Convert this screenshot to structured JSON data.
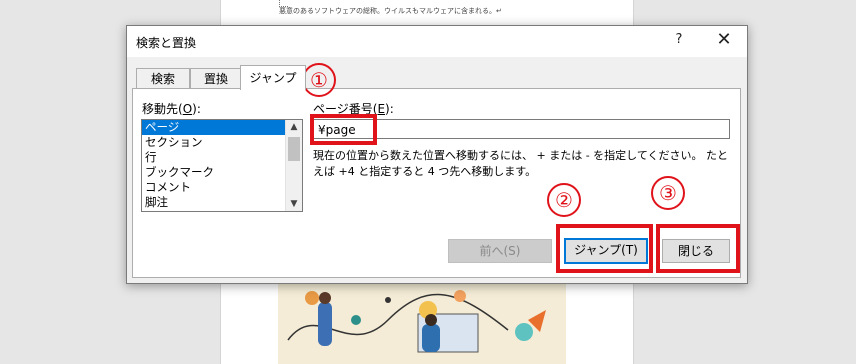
{
  "document": {
    "text_line": "悪意のあるソフトウェアの総称。ウイルスもマルウェアに含まれる。↵"
  },
  "dialog": {
    "title": "検索と置換",
    "help_label": "?",
    "close_label": "✕",
    "tabs": [
      {
        "label": "検索"
      },
      {
        "label": "置換"
      },
      {
        "label": "ジャンプ"
      }
    ],
    "target_label_prefix": "移動先(",
    "target_label_key": "O",
    "target_label_suffix": "):",
    "target_items": [
      {
        "label": "ページ"
      },
      {
        "label": "セクション"
      },
      {
        "label": "行"
      },
      {
        "label": "ブックマーク"
      },
      {
        "label": "コメント"
      },
      {
        "label": "脚注"
      }
    ],
    "page_label_prefix": "ページ番号(",
    "page_label_key": "E",
    "page_label_suffix": "):",
    "page_input_value": "¥page",
    "help_text": "現在の位置から数えた位置へ移動するには、 + または - を指定してください。 たとえば +4 と指定すると 4 つ先へ移動します。",
    "prev_button": "前へ(S)",
    "jump_button": "ジャンプ(T)",
    "close_button": "閉じる"
  },
  "annotations": {
    "step1": "①",
    "step2": "②",
    "step3": "③",
    "color": "#e0131b"
  }
}
